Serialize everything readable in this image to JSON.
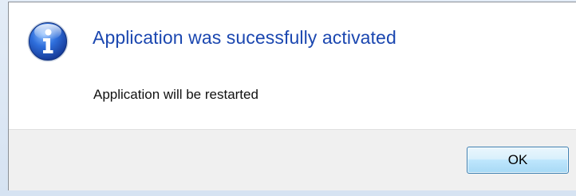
{
  "dialog": {
    "icon": "info-icon",
    "main_instruction": "Application was sucessfully activated",
    "message": "Application will be restarted",
    "ok_label": "OK"
  },
  "colors": {
    "main_instruction": "#1b47b0",
    "footer_background": "#f0f0f0",
    "button_border": "#3c7fb1"
  }
}
